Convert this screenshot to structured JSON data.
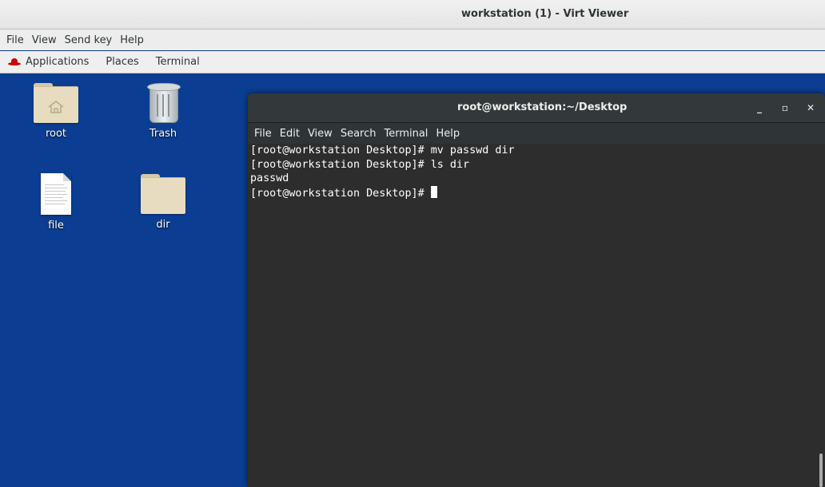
{
  "viewer": {
    "title": "workstation (1) - Virt Viewer",
    "menu": [
      "File",
      "View",
      "Send key",
      "Help"
    ]
  },
  "panel": {
    "icon": "redhat-icon",
    "items": [
      "Applications",
      "Places",
      "Terminal"
    ]
  },
  "desktop": {
    "icons": [
      {
        "label": "root",
        "icon": "home-folder-icon"
      },
      {
        "label": "Trash",
        "icon": "trash-icon"
      },
      {
        "label": "file",
        "icon": "text-file-icon"
      },
      {
        "label": "dir",
        "icon": "folder-icon"
      }
    ]
  },
  "terminal": {
    "title": "root@workstation:~/Desktop",
    "buttons": [
      "minimize",
      "maximize",
      "close"
    ],
    "button_glyphs": [
      "_",
      "▫",
      "✕"
    ],
    "menu": [
      "File",
      "Edit",
      "View",
      "Search",
      "Terminal",
      "Help"
    ],
    "lines": [
      "[root@workstation Desktop]# mv passwd dir",
      "[root@workstation Desktop]# ls dir",
      "passwd",
      "[root@workstation Desktop]# "
    ]
  },
  "colors": {
    "desktop_bg": "#0b3e92",
    "terminal_bg": "#2d2d2d",
    "terminal_fg": "#ffffff",
    "redhat_red": "#cc0000"
  }
}
